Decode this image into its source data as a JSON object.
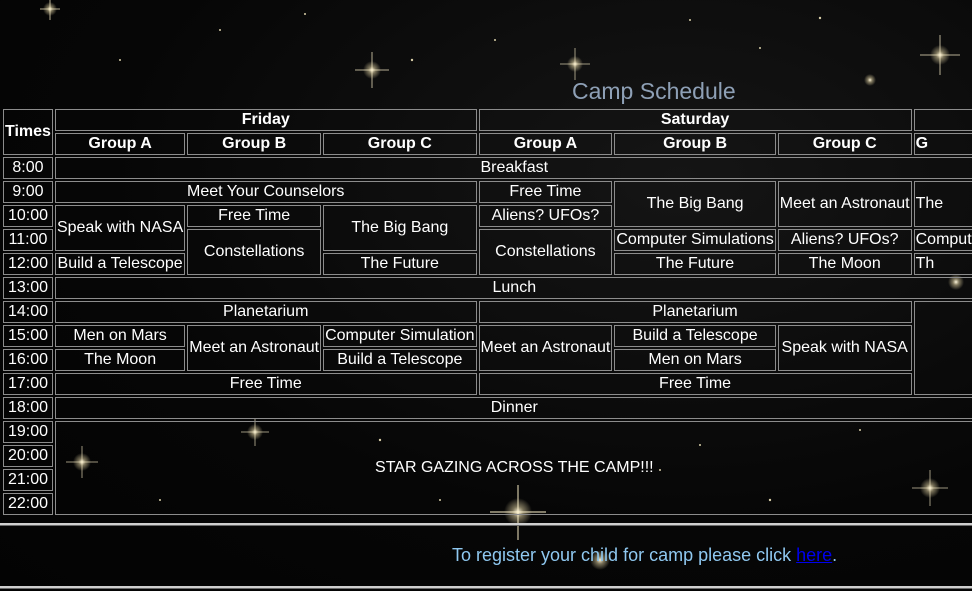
{
  "page": {
    "title": "Camp Schedule"
  },
  "schedule": {
    "times_header": "Times",
    "days": [
      "Friday",
      "Saturday"
    ],
    "groups": [
      "Group A",
      "Group B",
      "Group C",
      "Group A",
      "Group B",
      "Group C",
      "G"
    ],
    "times": [
      "8:00",
      "9:00",
      "10:00",
      "11:00",
      "12:00",
      "13:00",
      "14:00",
      "15:00",
      "16:00",
      "17:00",
      "18:00",
      "19:00",
      "20:00",
      "21:00",
      "22:00"
    ],
    "rows": {
      "breakfast": "Breakfast",
      "fri_meet_counselors": "Meet Your Counselors",
      "sat_a_free_time": "Free Time",
      "sat_b_big_bang": "The Big Bang",
      "sat_c_meet_astronaut": "Meet an Astronaut",
      "sun_a_partial": "The",
      "fri_a_speak_nasa": "Speak with NASA",
      "fri_b_free_time": "Free Time",
      "fri_c_big_bang": "The Big Bang",
      "sat_a_aliens": "Aliens? UFOs?",
      "fri_b_constellations": "Constellations",
      "sat_a_constellations": "Constellations",
      "sat_b_computer_sims": "Computer Simulations",
      "sat_c_aliens": "Aliens? UFOs?",
      "sun_a_computer_partial": "Comput",
      "fri_a_build_telescope": "Build a Telescope",
      "fri_c_future": "The Future",
      "sat_b_future": "The Future",
      "sat_c_moon": "The Moon",
      "sun_a_th_partial": "Th",
      "lunch": "Lunch",
      "fri_planetarium": "Planetarium",
      "sat_planetarium": "Planetarium",
      "fri_a_men_mars": "Men on Mars",
      "fri_b_meet_astronaut": "Meet an Astronaut",
      "fri_c_computer_sim": "Computer Simulation",
      "sat_a_meet_astronaut": "Meet an Astronaut",
      "sat_b_build_telescope": "Build a Telescope",
      "sat_c_speak_nasa": "Speak with NASA",
      "fri_a_moon": "The Moon",
      "fri_c_build_telescope": "Build a Telescope",
      "sat_b_men_mars": "Men on Mars",
      "fri_free_time": "Free Time",
      "sat_free_time": "Free Time",
      "dinner": "Dinner",
      "star_gazing": "STAR GAZING ACROSS THE CAMP!!!"
    }
  },
  "footer": {
    "register_text": "To register your child for camp please click ",
    "register_link": "here",
    "register_end": "."
  },
  "colors": {
    "background": "#050505",
    "title": "#8ea0b6",
    "register_text": "#8fc8f0",
    "link": "#0000ee",
    "cell_border": "#8c8c8c"
  }
}
